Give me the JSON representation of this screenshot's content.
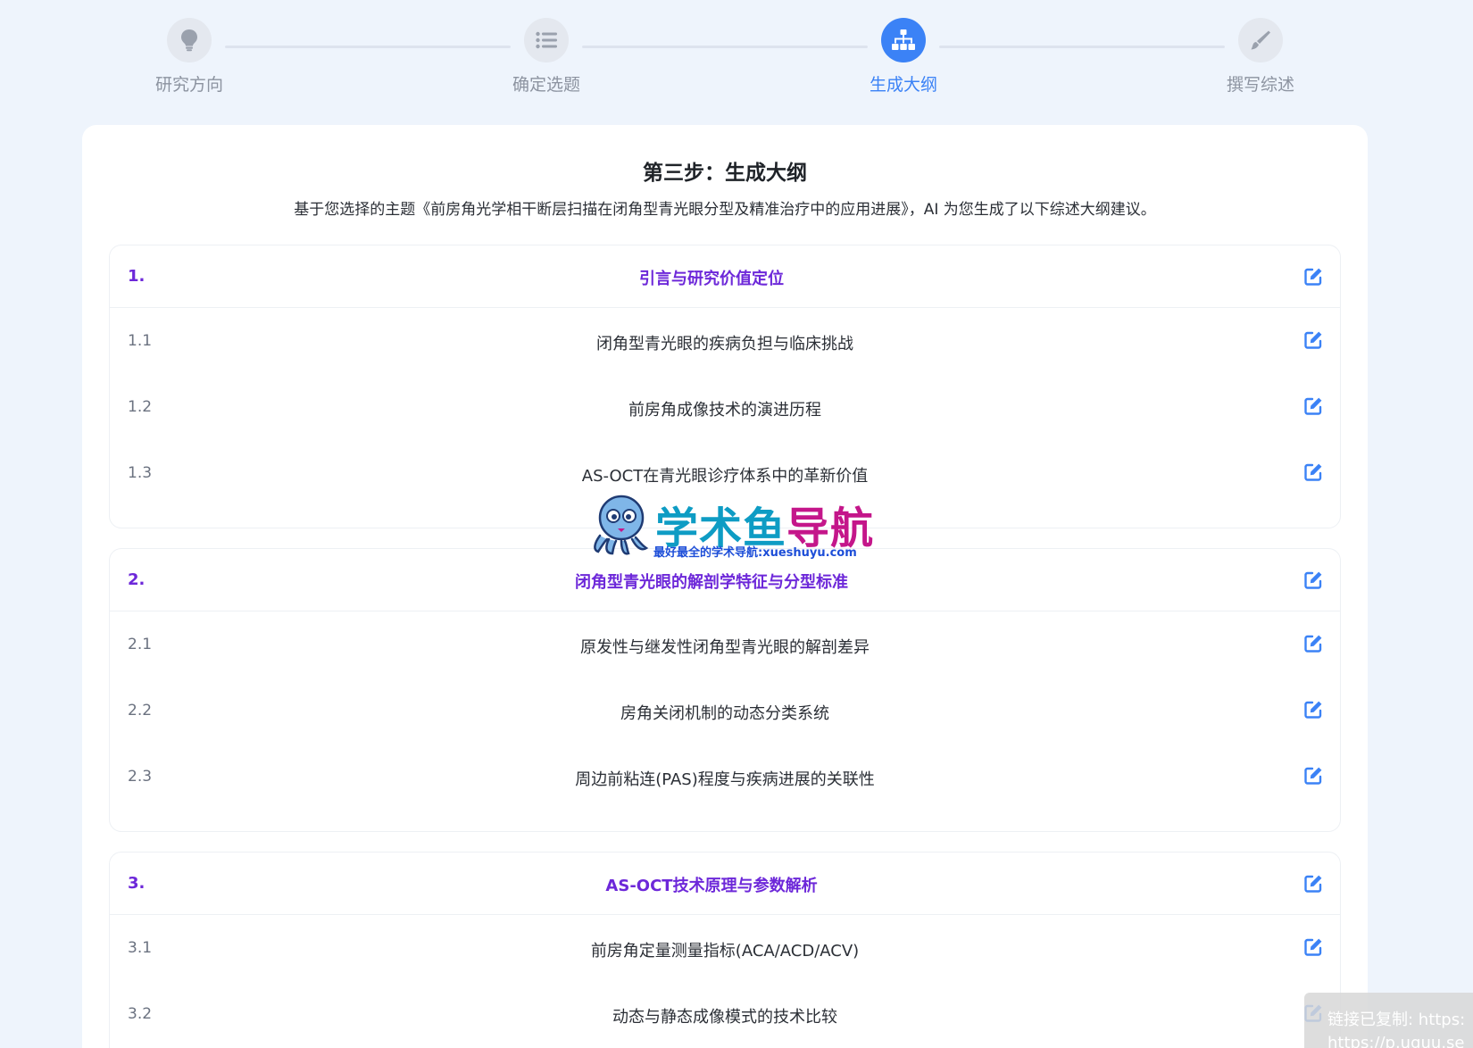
{
  "stepper": {
    "steps": [
      {
        "label": "研究方向",
        "icon": "lightbulb-icon",
        "active": false
      },
      {
        "label": "确定选题",
        "icon": "list-icon",
        "active": false
      },
      {
        "label": "生成大纲",
        "icon": "sitemap-icon",
        "active": true
      },
      {
        "label": "撰写综述",
        "icon": "pen-icon",
        "active": false
      }
    ]
  },
  "main": {
    "title": "第三步：生成大纲",
    "description": "基于您选择的主题《前房角光学相干断层扫描在闭角型青光眼分型及精准治疗中的应用进展》，AI 为您生成了以下综述大纲建议。",
    "sections": [
      {
        "number": "1.",
        "title": "引言与研究价值定位",
        "items": [
          {
            "number": "1.1",
            "title": "闭角型青光眼的疾病负担与临床挑战"
          },
          {
            "number": "1.2",
            "title": "前房角成像技术的演进历程"
          },
          {
            "number": "1.3",
            "title": "AS-OCT在青光眼诊疗体系中的革新价值"
          }
        ]
      },
      {
        "number": "2.",
        "title": "闭角型青光眼的解剖学特征与分型标准",
        "items": [
          {
            "number": "2.1",
            "title": "原发性与继发性闭角型青光眼的解剖差异"
          },
          {
            "number": "2.2",
            "title": "房角关闭机制的动态分类系统"
          },
          {
            "number": "2.3",
            "title": "周边前粘连(PAS)程度与疾病进展的关联性"
          }
        ]
      },
      {
        "number": "3.",
        "title": "AS-OCT技术原理与参数解析",
        "items": [
          {
            "number": "3.1",
            "title": "前房角定量测量指标(ACA/ACD/ACV)"
          },
          {
            "number": "3.2",
            "title": "动态与静态成像模式的技术比较"
          }
        ]
      }
    ]
  },
  "watermark": {
    "title_part1": "学术鱼",
    "title_part2": "导航",
    "subtitle": "最好最全的学术导航:xueshuyu.com"
  },
  "toast": {
    "line1": "链接已复制: https:",
    "line2": "https://p.uguu.se"
  },
  "colors": {
    "accent": "#3b82f6",
    "section_title": "#6d28d9",
    "edit_icon": "#3b82f6",
    "page_bg": "#eef4fc"
  }
}
